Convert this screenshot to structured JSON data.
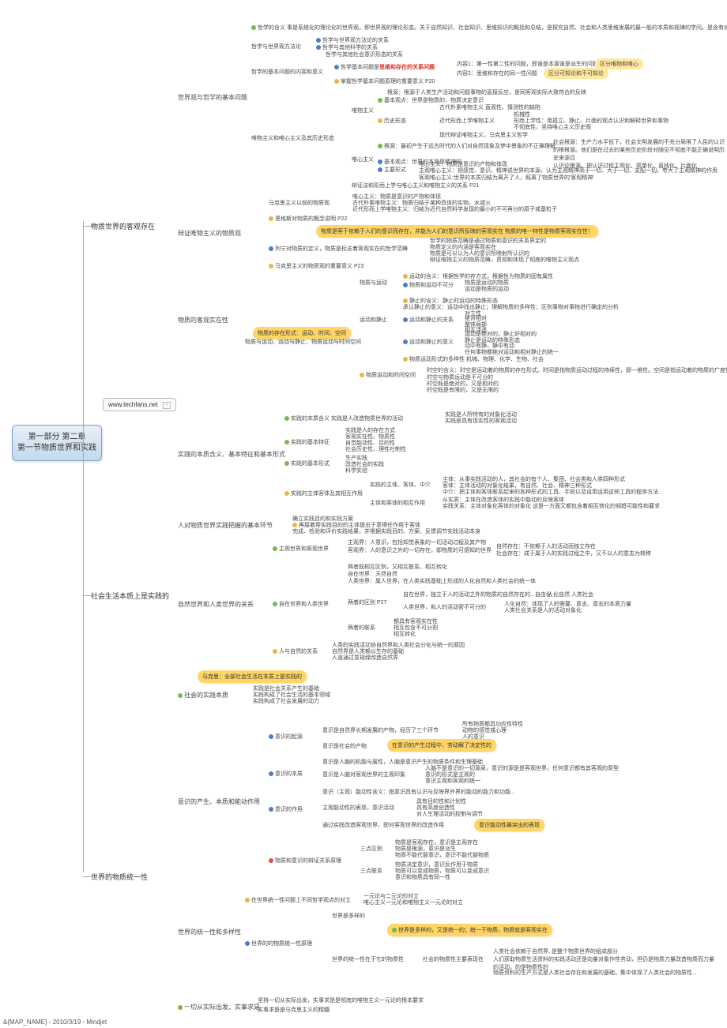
{
  "root": "第一部分 第二章\n第一节物质世界和实践",
  "website": "www.techfans.net",
  "footer": "&{MAP_NAME} - 2010/3/19 - Mindjet",
  "b1": "物质世界的客观存在",
  "b2": "社会生活本质上是实践的",
  "b3": "世界的物质统一性",
  "s1a": "世界观与哲学的基本问题",
  "s1b": "辩证唯物主义的物质观",
  "s1c": "物质的客观实在性",
  "s2a": "实践的本质含义、基本特征和基本形式",
  "s2b": "人对物质世界实践把握的基本环节",
  "s2c": "自然世界和人类世界的关系",
  "s2d": "社会的实践本质",
  "s3a": "意识的产生、本质和能动作用",
  "s3b": "世界的统一性和多样性",
  "s3c": "一切从实际出发、实事求是",
  "n": {
    "phil_def": "哲学的含义     事是系统化的理论化的世界观，即世界观的理论形态。关于自然知识、社会知识、思维知识的概括和总结，是探究自然、社会和人类思维发展的最一般的本质和规律的学问。是含有价值观念的最抽象的社会意识形态...",
    "phil_method": "哲学与世界观方法论",
    "pm1": "哲学与世界观方法论的关系",
    "pm2": "哲学与其他科学的关系",
    "pm3": "哲学与其他社会意识形态的关系",
    "basic_q": "哲学的基本问题的内容和意义",
    "basic_q1": "哲学基本问题是",
    "basic_q1r": "思维和存在的关系问题",
    "basic_q_c1": "内容1：第一性第二性的问题，即谁是本源谁是派生的问题",
    "basic_q_c2": "内容2：思维和存在的同一性问题",
    "hl_box1": "区分唯物和唯心",
    "hl_box2": "区分可知论和不可知论",
    "grasp": "掌握哲学基本问题原理的重要意义 P20",
    "mat_ideal": "唯物主义和唯心主义及其历史形态",
    "mat_root": "根源：根源于人类生产活动和问题事物的直接反应，是同客观实际大致符合的反映",
    "mat_view": "基本观点：世界是物质的，物质决定意识",
    "mat": "唯物主义",
    "mat_h1": "古代朴素唯物主义     直观性、猜测性的缺陷",
    "mat_hist": "历史形态",
    "mat_h2": "近代形而上学唯物主义",
    "mat_h2a": "机械性",
    "mat_h2b": "形而上学性：用孤立、静止、片面的观点认识和解释世界和事物",
    "mat_h2c": "不彻底性，坚持唯心主义历史观",
    "mat_h3": "现代辩证唯物主义，马克思主义哲学",
    "ideal_root": "根源：最初产生于远古时代的人们对自然现象及梦中景象的不正确理解",
    "ideal_social": "社会根源：生产力水平低下，社会文明发展的不充分局限了人民的认识\n的根根源。他们是在过去的某些历史阶段对随见不彻底不能正确说明历史来源且\n认识论根源。把认识过程主观化、简单化、直线化、片面化",
    "ideal": "唯心主义",
    "ideal_v": "基本观点：世界的本源是精神的",
    "ideal_s": "主要形式",
    "ideal_s1": "唯心主义：物质是意识的产物和体现\n主观唯心主义：把感觉、意识、精神说世界的本源，认为主观精神高于一切、大于一切、支配一切。夸大了主观精神的作用\n客观唯心主义:世界的本质归结为离开了人，既离了物质世界的'客观精神'",
    "bianzheng": "辩证法和形而上学与唯心主义和唯物主义的关系 P21",
    "marx_prev": "马克思主义以前的物质观",
    "marx_p1": "唯心主义：物质是意识的产物和体现",
    "marx_p2": "古代朴素唯物主义：物质归结于某种具体的实物，水或火",
    "marx_p3": "近代形而上学唯物主义：归结为近代自然科学发现的最小的不可再分的原子或基粒子",
    "engels": "恩格斯对物质的概念说明 P22",
    "callout_mat": "物质是客于依赖于人们的意识而存在，并能为人们的意识所反映的客观实在 物质的唯一特性是物质客观实在性！",
    "lenin": "列宁对物质的定义，物质是标志着客观实在的哲学范畴",
    "lenin1": "哲学的物质范畴是通过物质和意识的关系界定的",
    "lenin2": "物质定义的内涵是客观实在",
    "lenin3": "物质是可以认为人的意识所映射所认识的",
    "lenin4": "辩证唯物主义的物质范畴，贯彻和体现了彻底的唯物主义观点",
    "marx_sig": "马克思主义的物质观的重要意义 P23",
    "mat_mov": "物质与运动",
    "mov_def": "运动的含义：根据哲学的存方式，根据哲为物质的固有属性",
    "mov_rel": "物质和运动不可分",
    "mov_r1": "物质是运动的物质",
    "mov_r2": "运动是物质的运动",
    "still": "运动和静止",
    "still_def": "静止的含义：静止时运动的特殊形态",
    "still_ack": "承认静止的意义：运动中找出静止；理解物质的多样性；区别事物对事物进行确定的分析",
    "still_rel": "运动和静止的关系",
    "still_r1": "对立性",
    "still_r2": "绝对相对\n整体局部\n相互浮透",
    "still_sig": "运动和静止的意义",
    "still_s1": "运动是绝对的，静止好相对的\n静止是运动的特殊形态\n动中有静，静中有动\n任何事物都绝对运动和相对静止的统一",
    "mov_forms": "物质运动形式的多样性     机械、物理、化学、生物、社会",
    "mat_space": "物质运动和时间空间",
    "space1": "时空的含义：时空是运动着的物质的存在形式。时间是指物质运动过程的持续性，即一维性。空间是指运动着的物质的广度性、即三维性",
    "space2": "时空与物质运动是不可分的",
    "space3": "时空既是绝对的，又是相对的",
    "space4": "时空既是有限的，又是无限的",
    "callout_form": "物质的存在形式：运动、时间、空间",
    "mat_mov2": "物质与运动、运动与静止、物质运动与时间空间",
    "prac_def": "实践的本质含义     实践是人改造物质世界的活动",
    "prac_d1": "实践是人所特有的对象化活动",
    "prac_d2": "实践是具有现实性的客观活动",
    "prac_char": "实践的基本特征",
    "prac_c1": "实践是人的存在方式",
    "prac_c2": "客观实在性、物质性",
    "prac_c3": "自觉能动性、目的性",
    "prac_c4": "社会历史性、理性社制性",
    "prac_form": "实践的基本形式",
    "prac_f1": "生产实践",
    "prac_f2": "改造社会的实践",
    "prac_f3": "科学实验",
    "subj_obj": "实践的主体客体及其相互作用",
    "subj": "实践的主体、客体、中介",
    "subj1": "主体：从事实践活动的人，其社会的有个人、集团、社会类和人类四种形式",
    "subj2": "客体：主体活动的对象化结果，有自然、社会、精神三种形式",
    "subj3": "中介：把主体和客体联系起来的各种形式的工具、手段以及运用运用这些工具的程序方法...",
    "subj_act": "主体和客体的相互作用",
    "sa1": "从实质：主体在改造客体的实践中能动的反映客体",
    "sa2": "实践关系：主体对象化客体的对象化    这是一方面又都包含着相互转化的倾趋可能性和要求",
    "env1": "确立实践目的和实践方案",
    "env2": "再接着帮实践目的的主体提出于意得任作用于客体",
    "env3": "完成、检验和评价实践结果，并根据实践目的、方案、反馈调节实践活动本身",
    "zhuguan": "主观世界和客观世界",
    "zg1": "主观界：人意识，包括知觉表象的一切活动过程及其产物",
    "zg2": "客观界：人的意识之外的一切存在，即物质的可感知的世界",
    "zg2a": "自然存在：不依赖于人的活动而独立存在",
    "zg2b": "社会存在：成于属于人的实践过程之中，又不以人的意志为转移",
    "nat_world": "自在世界和人类世界",
    "nw1": "两者既相互区别，又相互联系、相互转化",
    "nw2": "自在世界：天然自然",
    "nw3": "人类世界：属人世界，在人类实践基础上形成的人化自然和人类社会的统一体",
    "nw_diff": "两者的区别 P27",
    "nwd1": "自在世界，独立于人的活动之外的物质的自然存在的...自由化",
    "nwd2": "人类世界，和人的活动密不可分的",
    "nwd2a": "人化自然   人类社会",
    "nwd2b": "人化自然：体现了人的需要、意志、意志的本质力量",
    "nwd2c": "人类社会关系是人的活动对象化",
    "nw_link": "两者的联系",
    "nwl1": "都具有客观实在性",
    "nwl2": "相互包含不可分割",
    "nwl3": "相互转化",
    "man_nat": "人与自然的关系",
    "mn1": "人类的实践活动协自然界和人类社会分化与统一的原因",
    "mn2": "自然界是人类赖以生存的基础",
    "mn3": "人道通过意规绿改造自然界",
    "callout_marx": "马克思：全部社会生活在本质上是实践的",
    "soc1": "实践是社会关系产生的基础",
    "soc2": "实践构成了社会生活的基本领域",
    "soc3": "实践构成了社会发展的动力",
    "con_orig": "意识的起源",
    "co1": "意识是自然界长期发展的产物，经历了三个环节",
    "co1a": "所有物质都具功应性特性",
    "co1b": "动物的感觉或心理",
    "co1c": "人的意识",
    "co2": "意识是社会的产物",
    "callout_labor": "在意识的产生过程中，劳动解了决定性的",
    "con_ess": "意识的本质",
    "ce1": "意识是人脑的机能与属性，人脑是意识产生的物质条件和生理基础",
    "ce2": "意识是人脑对客观世界的主观印象",
    "ce2a": "人脑不是意识的一切源泉，意识的源是是客观世界，任何意识都有其客观的原型",
    "ce2b": "意识的形式是主观的",
    "ce2c": "意识主观和客观的统一",
    "con_act": "意识的作用",
    "ca1": "意识（主观）能动性含义：指意识具有认识与反映界外界的能动的能力和功能...",
    "ca2": "主观能动性的表现，意识活动",
    "ca2a": "具有目的性和计划性",
    "ca2b": "具有高度创造性",
    "ca2c": "对人生理活动的控制与调节",
    "ca3": "通过实践改造客观世界，即对客观世界的改造作用",
    "callout_act": "意识能动性最突出的表现",
    "mat_con": "物质和意识的辩证关系原理",
    "mc_diff": "三点区别",
    "mcd1": "物质是客观存在，意识是主观存在",
    "mcd2": "物质是根源，意识是派生",
    "mcd3": "物质不能代替意识，意识不能代替物质",
    "mc_link": "三点联系",
    "mcl1": "物质决定意识，意识反作用于物质",
    "mcl2": "物质可以变成物质，物质可以变成意识",
    "mcl3": "意识和物质具有同一性",
    "unity_phil": "在世界统一性问题上不同哲学观点的对立",
    "up1": "一元论与二元论的对立",
    "up2": "唯心主义一元论和唯物主义一元论的对立",
    "unity_mat": "世界的的物质统一性原理",
    "um1": "世界是多样的",
    "callout_unity": "世界是多样的，又是统一的；统一于物质，物质就是客观实在",
    "um2": "世界的统一性在于它的物质性",
    "um2a": "社会的物质性主要表现在",
    "um2a1": "人类社会依赖于自然界, 是整个物质世界的组成部分",
    "um2a2": "人们获取物质生活资料的实践活动还是向量对象作性劳动，但仍是物质力量改造物质而力量的活动，的是物质性的",
    "um2a3": "物质资料的生产方式是人类社会存在和发展的基础，集中体现了人类社会的物质性...",
    "ssj1": "坚持一切从实际出发，实事求是是彻底的唯物主义一元论的根本要求",
    "ssj2": "实事求是是马克思主义的精髓"
  }
}
